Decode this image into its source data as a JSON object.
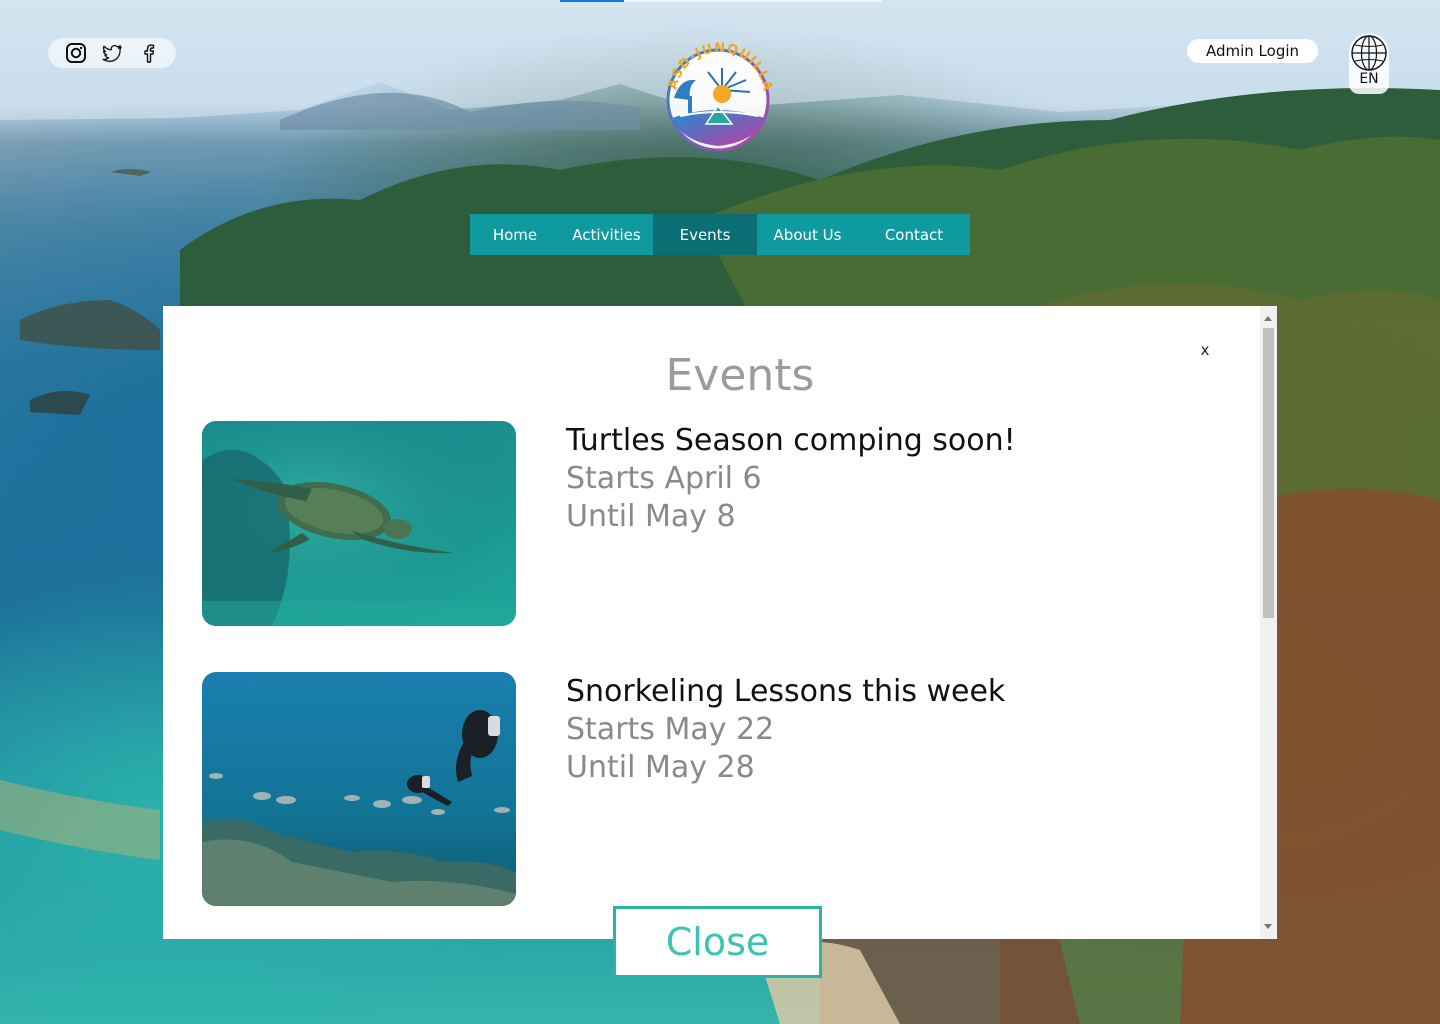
{
  "top_progress": {
    "value": 0.2
  },
  "social": {
    "icons": [
      "instagram-icon",
      "twitter-icon",
      "facebook-icon"
    ]
  },
  "logo": {
    "text": "ASD-JUNQUILLAL"
  },
  "header": {
    "admin_login": "Admin Login",
    "language": "EN"
  },
  "nav": {
    "items": [
      {
        "label": "Home"
      },
      {
        "label": "Activities"
      },
      {
        "label": "Events"
      },
      {
        "label": "About Us"
      },
      {
        "label": "Contact"
      }
    ],
    "active_index": 2,
    "color": "#0f9aa0",
    "active_color": "#0a6e74"
  },
  "modal": {
    "title": "Events",
    "close_x": "x",
    "events": [
      {
        "title": "Turtles Season comping soon!",
        "starts": "Starts April 6",
        "until": "Until May 8",
        "image": "sea-turtle-underwater"
      },
      {
        "title": "Snorkeling Lessons this week",
        "starts": "Starts May 22",
        "until": "Until May 28",
        "image": "divers-with-fish-over-reef"
      }
    ],
    "close_button": "Close",
    "accent_color": "#2bb3a3"
  }
}
